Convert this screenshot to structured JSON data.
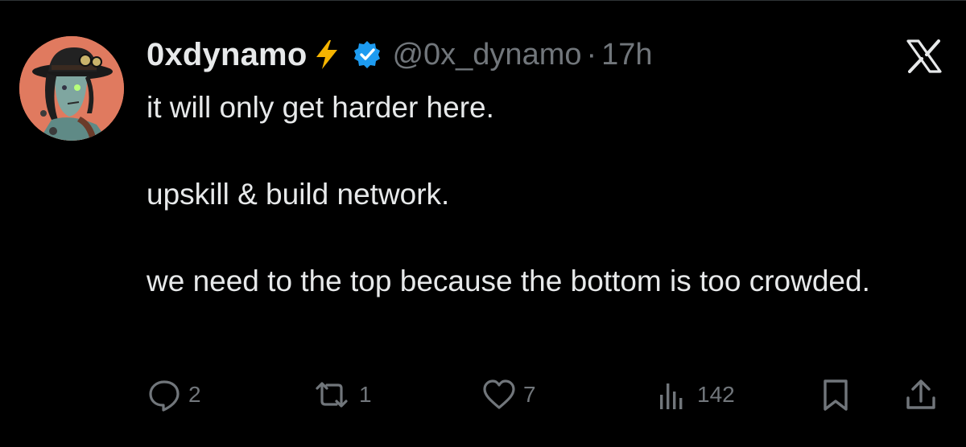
{
  "tweet": {
    "author_name": "0xdynamo",
    "handle": "@0x_dynamo",
    "separator": "·",
    "timestamp": "17h",
    "lines": [
      "it will only get harder here.",
      "upskill & build network.",
      "we need to the top because the bottom is too crowded."
    ]
  },
  "actions": {
    "reply_count": "2",
    "repost_count": "1",
    "like_count": "7",
    "views_count": "142"
  },
  "icons": {
    "bolt": "lightning-bolt",
    "verified": "verified-badge",
    "logo": "x-logo",
    "reply": "speech-bubble",
    "repost": "repost-arrows",
    "like": "heart",
    "views": "bar-chart",
    "bookmark": "bookmark",
    "share": "share-upload"
  },
  "colors": {
    "background": "#000000",
    "text": "#e7e9ea",
    "muted": "#71767b",
    "verified_blue": "#1d9bf0",
    "bolt_yellow": "#f5b400",
    "avatar_bg": "#e07a5f"
  }
}
